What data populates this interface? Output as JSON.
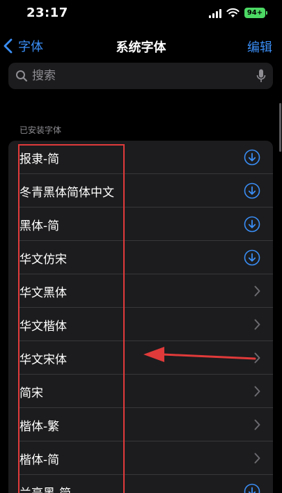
{
  "status_bar": {
    "time": "23:17",
    "battery": "94+"
  },
  "nav": {
    "back_label": "字体",
    "title": "系统字体",
    "edit_label": "编辑"
  },
  "search": {
    "placeholder": "搜索"
  },
  "section": {
    "header": "已安装字体",
    "items": [
      {
        "label": "报隶-简",
        "action": "download-icon"
      },
      {
        "label": "冬青黑体简体中文",
        "action": "download-icon"
      },
      {
        "label": "黑体-简",
        "action": "download-icon"
      },
      {
        "label": "华文仿宋",
        "action": "download-icon"
      },
      {
        "label": "华文黑体",
        "action": "chevron-right-icon"
      },
      {
        "label": "华文楷体",
        "action": "chevron-right-icon"
      },
      {
        "label": "华文宋体",
        "action": "chevron-right-icon"
      },
      {
        "label": "简宋",
        "action": "chevron-right-icon"
      },
      {
        "label": "楷体-繁",
        "action": "chevron-right-icon"
      },
      {
        "label": "楷体-简",
        "action": "chevron-right-icon"
      },
      {
        "label": "兰亭黑-简",
        "action": "download-icon"
      }
    ]
  },
  "colors": {
    "accent": "#3a8ef6",
    "annotation": "#e03a3a",
    "battery": "#4cd964"
  }
}
